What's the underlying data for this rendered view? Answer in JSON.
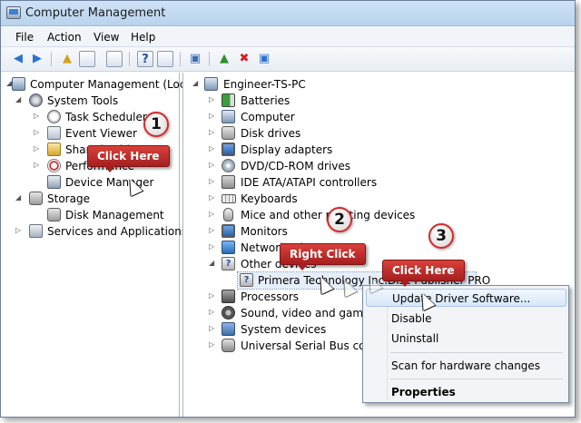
{
  "window": {
    "title": "Computer Management"
  },
  "menu": {
    "items": [
      "File",
      "Action",
      "View",
      "Help"
    ]
  },
  "toolbar": {
    "icons": [
      "back-icon",
      "forward-icon",
      "up-icon",
      "show-hide-tree-icon",
      "properties-icon",
      "help-icon",
      "show-action-pane-icon",
      "scan-hardware-icon",
      "update-driver-icon",
      "uninstall-icon",
      "enable-icon"
    ]
  },
  "left_tree": {
    "root": "Computer Management (Local",
    "system_tools": "System Tools",
    "task_scheduler": "Task Scheduler",
    "event_viewer": "Event Viewer",
    "shared_folders": "Shared Folders",
    "performance": "Performance",
    "device_manager": "Device Manager",
    "storage": "Storage",
    "disk_management": "Disk Management",
    "services": "Services and Applications"
  },
  "right_tree": {
    "root": "Engineer-TS-PC",
    "items": {
      "batteries": "Batteries",
      "computer": "Computer",
      "disk_drives": "Disk drives",
      "display": "Display adapters",
      "dvd": "DVD/CD-ROM drives",
      "ide": "IDE ATA/ATAPI controllers",
      "keyboards": "Keyboards",
      "mice": "Mice and other pointing devices",
      "monitors": "Monitors",
      "network": "Network adapters",
      "other": "Other devices",
      "other_child": "Primera Technology Inc.Disc Publisher PRO",
      "processors": "Processors",
      "sound": "Sound, video and game controllers",
      "system": "System devices",
      "usb": "Universal Serial Bus controllers"
    }
  },
  "context_menu": {
    "update": "Update Driver Software...",
    "disable": "Disable",
    "uninstall": "Uninstall",
    "scan": "Scan for hardware changes",
    "properties": "Properties"
  },
  "annotations": {
    "step1": "1",
    "step2": "2",
    "step3": "3",
    "callout1": "Click Here",
    "callout2": "Right Click",
    "callout3": "Click Here"
  },
  "colors": {
    "callout": "#b82a26",
    "badge_border": "#d22b2b"
  }
}
